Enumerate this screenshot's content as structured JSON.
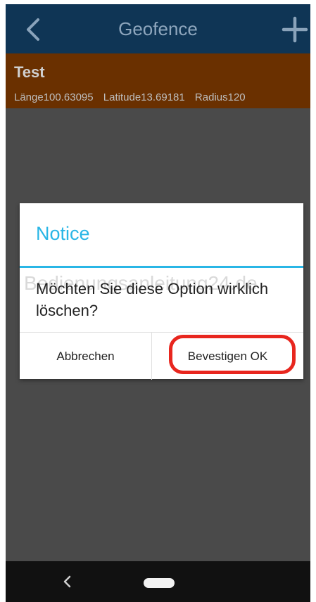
{
  "appbar": {
    "title": "Geofence",
    "back_icon": "chevron-left-icon",
    "add_icon": "plus-icon"
  },
  "geofence_list": {
    "items": [
      {
        "name": "Test",
        "longitude_label": "Länge100.63095",
        "latitude_label": "Latitude13.69181",
        "radius_label": "Radius120"
      }
    ]
  },
  "dialog": {
    "title": "Notice",
    "message": "Möchten Sie diese Option wirklich löschen?",
    "watermark": "Bedienungsanleitung24.de",
    "cancel_label": "Abbrechen",
    "confirm_label": "Bevestigen OK"
  },
  "colors": {
    "appbar": "#0f3555",
    "list_item": "#6a3000",
    "accent": "#29b6e6",
    "highlight": "#e8261e"
  },
  "system_nav": {
    "back_icon": "nav-back-icon",
    "home_icon": "nav-home-icon"
  }
}
